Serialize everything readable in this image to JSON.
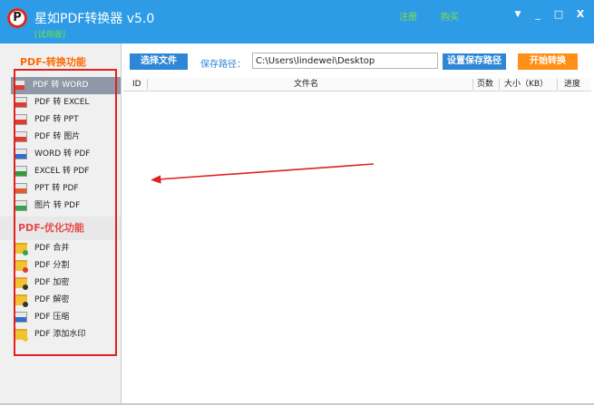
{
  "app": {
    "logo_letter": "P",
    "title": "星如PDF转换器 v5.0",
    "trial_label": "[试用版]",
    "register_label": "注册",
    "buy_label": "购买"
  },
  "window_controls": {
    "menu_glyph": "▼",
    "minimize_glyph": "_",
    "maximize_glyph": "□",
    "close_glyph": "X"
  },
  "toolbar": {
    "select_file_label": "选择文件",
    "save_path_label": "保存路径：",
    "save_path_value": "C:\\Users\\lindewei\\Desktop",
    "set_save_path_label": "设置保存路径",
    "start_convert_label": "开始转换"
  },
  "sidebar": {
    "convert_section_title": "PDF-转换功能",
    "convert_items": [
      {
        "label": "PDF 转 WORD",
        "icon": "pdf-file-icon",
        "color": "#e23b2f",
        "active": true
      },
      {
        "label": "PDF 转 EXCEL",
        "icon": "pdf-file-icon",
        "color": "#e23b2f"
      },
      {
        "label": "PDF 转 PPT",
        "icon": "pdf-file-icon",
        "color": "#e23b2f"
      },
      {
        "label": "PDF 转 图片",
        "icon": "pdf-file-icon",
        "color": "#e23b2f"
      },
      {
        "label": "WORD 转 PDF",
        "icon": "word-file-icon",
        "color": "#2f6fd0"
      },
      {
        "label": "EXCEL 转 PDF",
        "icon": "excel-file-icon",
        "color": "#2e9b3d"
      },
      {
        "label": "PPT 转 PDF",
        "icon": "ppt-file-icon",
        "color": "#e55b2a"
      },
      {
        "label": "图片 转 PDF",
        "icon": "image-file-icon",
        "color": "#3aa24a"
      }
    ],
    "optimize_section_title": "PDF-优化功能",
    "optimize_items": [
      {
        "label": "PDF 合并",
        "icon": "merge-folder-icon",
        "color": "#3aa24a"
      },
      {
        "label": "PDF 分割",
        "icon": "split-folder-icon",
        "color": "#e23b2f"
      },
      {
        "label": "PDF 加密",
        "icon": "lock-folder-icon",
        "color": "#333333"
      },
      {
        "label": "PDF 解密",
        "icon": "unlock-folder-icon",
        "color": "#333333"
      },
      {
        "label": "PDF 压缩",
        "icon": "compress-icon",
        "color": "#2f6fd0"
      },
      {
        "label": "PDF 添加水印",
        "icon": "watermark-icon",
        "color": "#f2c235"
      }
    ]
  },
  "table": {
    "columns": [
      "ID",
      "文件名",
      "页数",
      "大小（KB）",
      "进度"
    ],
    "rows": []
  },
  "colors": {
    "titlebar": "#2e9be6",
    "accent_blue": "#2e86d6",
    "accent_orange": "#ff8f16",
    "section_convert": "#ff6a00",
    "section_optimize": "#e64a4a",
    "annotation_red": "#e02121"
  }
}
